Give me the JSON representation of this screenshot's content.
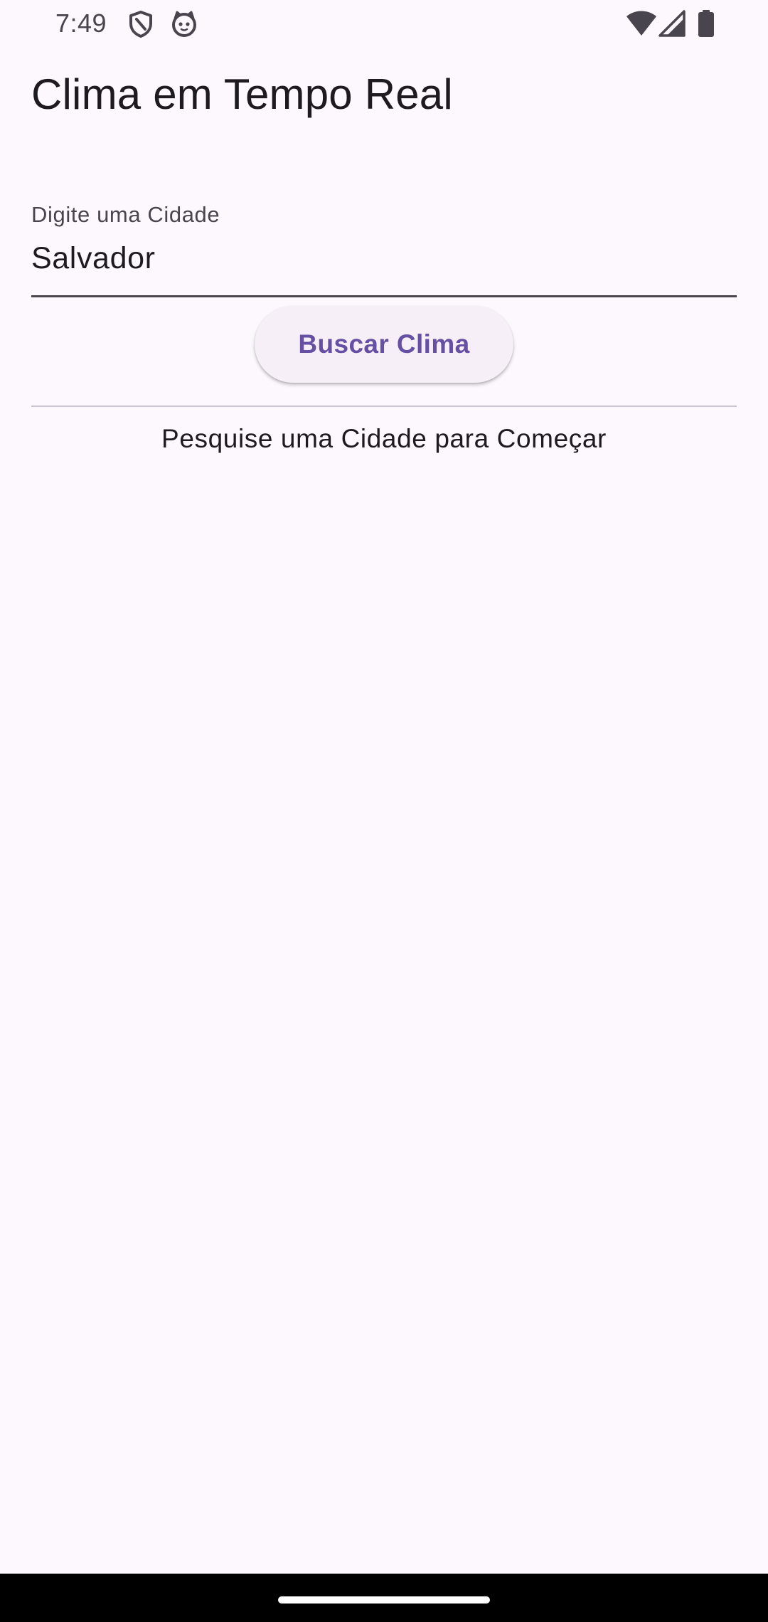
{
  "status_bar": {
    "time": "7:49",
    "icons": [
      "shield-icon",
      "cat-icon",
      "wifi-icon",
      "signal-icon",
      "battery-icon"
    ]
  },
  "app_bar": {
    "title": "Clima em Tempo Real"
  },
  "search": {
    "label": "Digite uma Cidade",
    "value": "Salvador"
  },
  "button": {
    "label": "Buscar Clima"
  },
  "content": {
    "empty_message": "Pesquise uma Cidade para Começar"
  },
  "colors": {
    "background": "#fdf7fe",
    "accent": "#6750a4",
    "button_bg": "#f6eff7",
    "text": "#1d1b20",
    "secondary_text": "#49454f"
  }
}
